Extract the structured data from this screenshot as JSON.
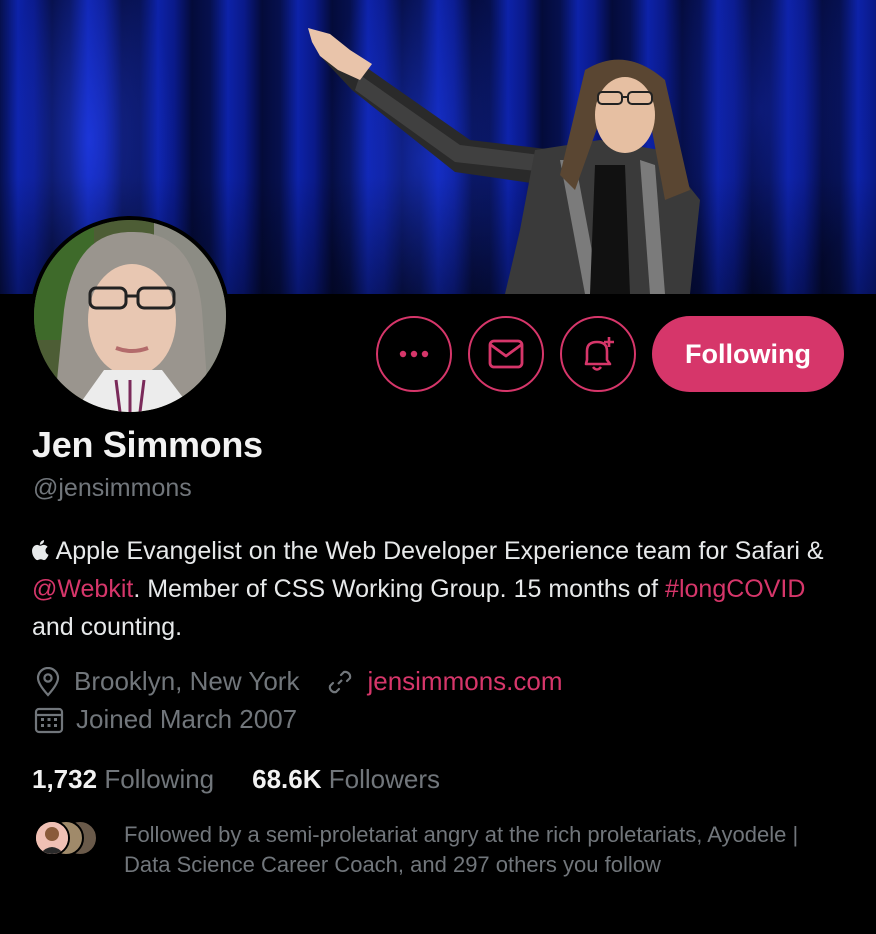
{
  "profile": {
    "name": "Jen Simmons",
    "handle": "@jensimmons",
    "bio": {
      "part1": " Apple Evangelist on the Web Developer Experience team for Safari & ",
      "mention": "@Webkit",
      "part2": ". Member of CSS Working Group. 15 months of ",
      "hashtag": "#longCOVID",
      "part3": " and counting."
    },
    "location": "Brooklyn, New York",
    "website": "jensimmons.com",
    "joined": "Joined March 2007",
    "following_count": "1,732",
    "following_label": "Following",
    "followers_count": "68.6K",
    "followers_label": "Followers",
    "followed_by": "Followed by a semi-proletariat angry at the rich proletariats, Ayodele | Data Science Career Coach, and 297 others you follow"
  },
  "actions": {
    "follow_label": "Following",
    "more_icon": "more-icon",
    "message_icon": "envelope-icon",
    "notify_icon": "bell-plus-icon"
  },
  "colors": {
    "accent": "#d6366a",
    "background": "#000000",
    "secondary_text": "#71767b"
  }
}
